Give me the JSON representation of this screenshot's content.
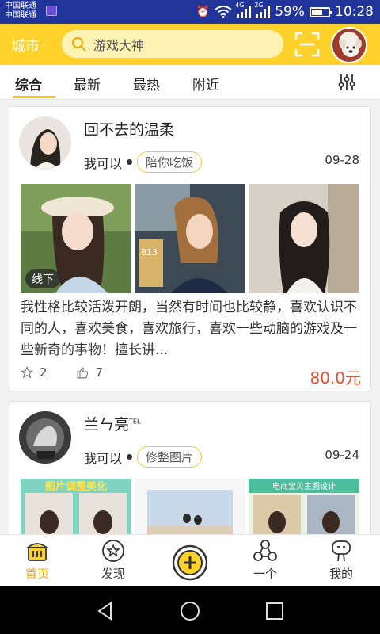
{
  "status_bar": {
    "carrier_1": "中国联通",
    "carrier_2": "中国联通",
    "signal_1_tag": "4G",
    "signal_2_tag": "2G",
    "battery": "59%",
    "time": "10:28"
  },
  "header": {
    "city": "城市",
    "search_placeholder": "游戏大神",
    "brand_color": "#ffd22b"
  },
  "tabs": [
    {
      "label": "综合",
      "active": true
    },
    {
      "label": "最新",
      "active": false
    },
    {
      "label": "最热",
      "active": false
    },
    {
      "label": "附近",
      "active": false
    }
  ],
  "feed": [
    {
      "name": "回不去的温柔",
      "name_badge": "",
      "role": "我可以",
      "skill": "陪你吃饭",
      "date": "09-28",
      "photo_badge": "线下",
      "photo_text_1": "813",
      "description": "我性格比较活泼开朗，当然有时间也比较静，喜欢认识不同的人，喜欢美食，喜欢旅行，喜欢一些动脑的游戏及一些新奇的事物！擅长讲...",
      "likes": "2",
      "thumbs": "7",
      "price": "80.0元"
    },
    {
      "name": "兰ㄣ亮",
      "name_badge": "TEL",
      "role": "我可以",
      "skill": "修整图片",
      "date": "09-24",
      "photo_caption_1": "图片调整美化",
      "photo_caption_3": "电商宝贝主图设计"
    }
  ],
  "bottom_nav": [
    {
      "label": "首页",
      "icon": "home-icon",
      "active": true
    },
    {
      "label": "发现",
      "icon": "discover-icon",
      "active": false
    },
    {
      "label": "",
      "icon": "plus-icon",
      "active": false
    },
    {
      "label": "一个",
      "icon": "share-nodes-icon",
      "active": false
    },
    {
      "label": "我的",
      "icon": "profile-icon",
      "active": false
    }
  ],
  "colors": {
    "accent": "#ffc400",
    "price": "#e84b2c",
    "status_bar": "#21349a"
  }
}
